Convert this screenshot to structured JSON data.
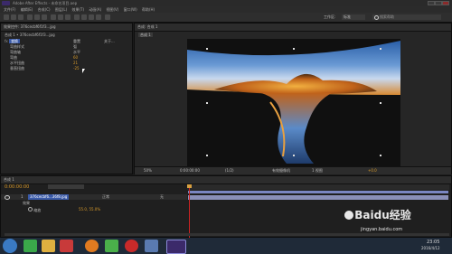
{
  "window": {
    "title": "Adobe After Effects - 未命名项目.aep"
  },
  "menu": [
    "文件(F)",
    "编辑(E)",
    "合成(C)",
    "图层(L)",
    "效果(T)",
    "动画(A)",
    "视图(V)",
    "窗口(W)",
    "帮助(H)"
  ],
  "workspace": {
    "label": "工作区:",
    "value": "标准",
    "search_placeholder": "搜索帮助"
  },
  "effects_panel": {
    "tab_label": "效果控件: 376cecbf6f1f3...jpg",
    "layer_path": "合成 1 • 376cecbf6f1f3...jpg",
    "effect_name": "变换",
    "reset_label": "重置",
    "about_label": "关于...",
    "params": [
      {
        "name": "弯曲样式",
        "value": "弧"
      },
      {
        "name": "弯曲轴",
        "value": "水平"
      },
      {
        "name": "弯曲",
        "value": "60"
      },
      {
        "name": "水平扭曲",
        "value": "21"
      },
      {
        "name": "垂直扭曲",
        "value": "-25"
      }
    ]
  },
  "composition": {
    "tab_label": "合成: 合成 1",
    "crumb": "合成 1",
    "zoom": "50%",
    "timecode": "0:00:00:00",
    "resolution": "(1/2)",
    "camera": "有效摄像机",
    "view": "1 视图",
    "exposure": "+0.0"
  },
  "timeline": {
    "tab_label": "合成 1",
    "timecode": "0:00:00:00",
    "layer_name": "376cecbf6...36f8.jpg",
    "layer_mode": "正常",
    "parent": "无",
    "effects_label": "效果",
    "transform_label": "缩放",
    "scale_value": "55.0, 55.0%"
  },
  "taskbar": {
    "time": "23:05",
    "date": "2016/4/12"
  },
  "watermark": {
    "brand": "Baidu经验",
    "url": "jingyan.baidu.com"
  },
  "colors": {
    "accent": "#d89a2a",
    "playhead": "#cc2222",
    "timebar": "#7a86c2",
    "layer_bar": "#8a8fb8"
  }
}
